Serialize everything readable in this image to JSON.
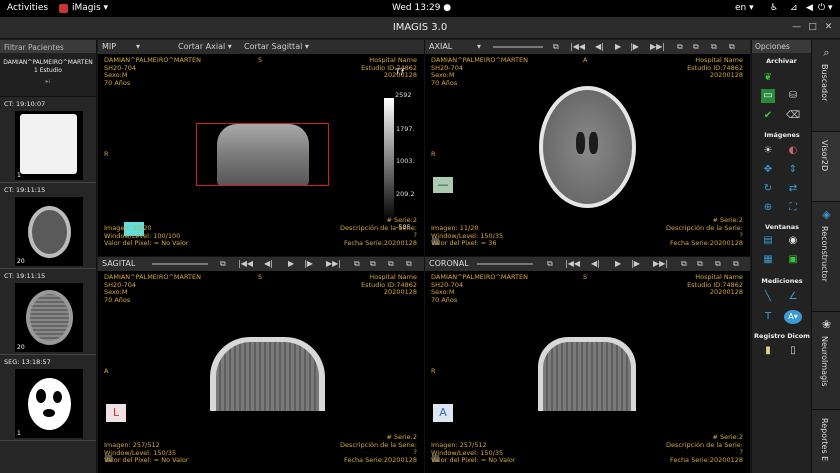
{
  "topbar": {
    "activities": "Activities",
    "app": "iMagis",
    "clock": "Wed 13:29",
    "lang": "en",
    "power": "⏻"
  },
  "window": {
    "title": "IMAGIS 3.0"
  },
  "left": {
    "filter": "Filtrar Pacientes",
    "patient_name": "DAMIAN^PALMEIRO^MARTEN",
    "studies": "1 Estudio",
    "series": [
      {
        "label": "CT: 19:10:07",
        "count": "1"
      },
      {
        "label": "CT: 19:11:15",
        "count": "20"
      },
      {
        "label": "CT: 19:11:15",
        "count": "20"
      },
      {
        "label": "SEG: 13:18:57",
        "count": "1"
      }
    ]
  },
  "panes": {
    "mip": {
      "title": "MIP",
      "opt1": "Cortar Axial",
      "opt2": "Cortar Sagittal",
      "name": "DAMIAN^PALMEIRO^MARTEN",
      "id": "SH20-704",
      "sex": "Sexo:M",
      "age": "70 Años",
      "hospital": "Hospital Name",
      "estudio": "Estudio ID:74862",
      "date": "20200128",
      "orient_top": "S",
      "orient_left": "R",
      "imagen": "Imagen: 20/20",
      "wl": "Window/Level: 100/100",
      "pixel": "Valor del Pixel: = No Valor",
      "serie": "# Serie:2",
      "desc": "Descripción de la Serie:",
      "desc_val": "?",
      "fecha": "Fecha Serie:20200128",
      "colorbar": [
        "2592",
        "1797.",
        "1003.",
        "209.2",
        "-585"
      ]
    },
    "axial": {
      "title": "AXIAL",
      "name": "DAMIAN^PALMEIRO^MARTEN",
      "id": "SH20-704",
      "sex": "Sexo:M",
      "age": "70 Años",
      "hospital": "Hospital Name",
      "estudio": "Estudio ID:74862",
      "date": "20200128",
      "orient_top": "A",
      "orient_left": "R",
      "imagen": "Imagen: 11/20",
      "wl": "Window/Level: 150/35",
      "pixel": "Valor del Pixel: = 36",
      "serie": "# Serie:2",
      "desc": "Descripción de la Serie:",
      "desc_val": "?",
      "fecha": "Fecha Serie:20200128"
    },
    "sagital": {
      "title": "SAGITAL",
      "name": "DAMIAN^PALMEIRO^MARTEN",
      "id": "SH20-704",
      "sex": "Sexo:M",
      "age": "70 Años",
      "hospital": "Hospital Name",
      "estudio": "Estudio ID:74862",
      "date": "20200128",
      "orient_top": "S",
      "orient_left": "A",
      "imagen": "Imagen: 257/512",
      "wl": "Window/Level: 150/35",
      "pixel": "Valor del Pixel: = No Valor",
      "serie": "# Serie:2",
      "desc": "Descripción de la Serie:",
      "desc_val": "?",
      "fecha": "Fecha Serie:20200128",
      "marker": "L"
    },
    "coronal": {
      "title": "CORONAL",
      "name": "DAMIAN^PALMEIRO^MARTEN",
      "id": "SH20-704",
      "sex": "Sexo:M",
      "age": "70 Años",
      "hospital": "Hospital Name",
      "estudio": "Estudio ID:74862",
      "date": "20200128",
      "orient_top": "S",
      "orient_left": "R",
      "imagen": "Imagen: 257/512",
      "wl": "Window/Level: 150/35",
      "pixel": "Valor del Pixel: = No Valor",
      "serie": "# Serie:2",
      "desc": "Descripción de la Serie:",
      "desc_val": "?",
      "fecha": "Fecha Serie:20200128",
      "marker": "A"
    }
  },
  "right": {
    "header": "Opciones",
    "archivar": "Archivar",
    "imagenes": "Imágenes",
    "ventanas": "Ventanas",
    "mediciones": "Mediciones",
    "registro": "Registro Dicom"
  },
  "tabs": {
    "buscador": "Buscador",
    "visor": "Visor2D",
    "reconstructor": "Reconstructor",
    "neuroimagis": "NeuroImagis",
    "reportes": "Reportes E"
  },
  "colors": {
    "overlay": "#d6a73c",
    "accent": "#3a9bd9",
    "selection": "#d11f1f"
  }
}
